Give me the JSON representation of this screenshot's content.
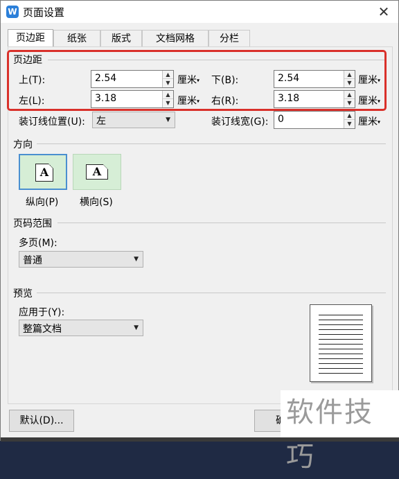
{
  "window": {
    "title": "页面设置",
    "app_icon": "W"
  },
  "tabs": [
    {
      "label": "页边距",
      "active": true
    },
    {
      "label": "纸张",
      "active": false
    },
    {
      "label": "版式",
      "active": false
    },
    {
      "label": "文档网格",
      "active": false
    },
    {
      "label": "分栏",
      "active": false
    }
  ],
  "margins": {
    "section_label": "页边距",
    "top_label": "上(T):",
    "top_value": "2.54",
    "bottom_label": "下(B):",
    "bottom_value": "2.54",
    "left_label": "左(L):",
    "left_value": "3.18",
    "right_label": "右(R):",
    "right_value": "3.18",
    "unit": "厘米",
    "gutter_pos_label": "装订线位置(U):",
    "gutter_pos_value": "左",
    "gutter_width_label": "装订线宽(G):",
    "gutter_width_value": "0"
  },
  "orientation": {
    "section_label": "方向",
    "glyph": "A",
    "portrait_label": "纵向(P)",
    "landscape_label": "横向(S)",
    "selected": "portrait"
  },
  "page_range": {
    "section_label": "页码范围",
    "multi_label": "多页(M):",
    "multi_value": "普通"
  },
  "preview": {
    "section_label": "预览",
    "apply_label": "应用于(Y):",
    "apply_value": "整篇文档"
  },
  "buttons": {
    "default_label": "默认(D)...",
    "ok_partial": "确"
  },
  "watermark_text": "软件技巧",
  "colors": {
    "highlight": "#d9302a",
    "orientation_bg": "#d6eed6",
    "selected_border": "#4a8fd0"
  }
}
